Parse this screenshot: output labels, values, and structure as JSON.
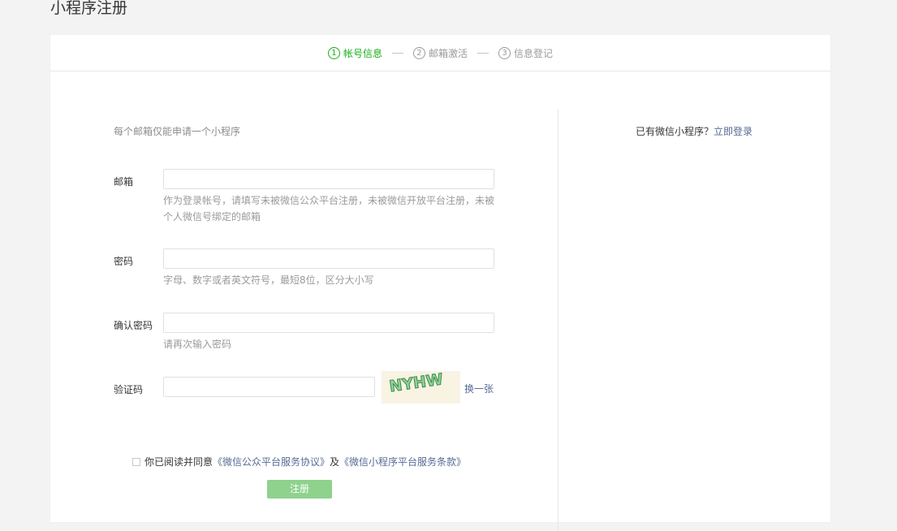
{
  "page": {
    "title": "小程序注册"
  },
  "steps": [
    {
      "num": "1",
      "label": "帐号信息"
    },
    {
      "num": "2",
      "label": "邮箱激活"
    },
    {
      "num": "3",
      "label": "信息登记"
    }
  ],
  "form": {
    "intro": "每个邮箱仅能申请一个小程序",
    "email": {
      "label": "邮箱",
      "value": "",
      "hint": "作为登录帐号，请填写未被微信公众平台注册，未被微信开放平台注册，未被个人微信号绑定的邮箱"
    },
    "password": {
      "label": "密码",
      "value": "",
      "hint": "字母、数字或者英文符号，最短8位，区分大小写"
    },
    "confirm_password": {
      "label": "确认密码",
      "value": "",
      "hint": "请再次输入密码"
    },
    "captcha": {
      "label": "验证码",
      "value": "",
      "image_text": "NYHW",
      "switch_label": "换一张"
    },
    "agreement": {
      "prefix": "你已阅读并同意",
      "link1": "《微信公众平台服务协议》",
      "and": "及",
      "link2": "《微信小程序平台服务条款》"
    },
    "submit_label": "注册"
  },
  "side": {
    "question": "已有微信小程序？",
    "login_link": "立即登录"
  },
  "colors": {
    "accent": "#1aad19",
    "link": "#576b95",
    "button_disabled": "#8ed28d",
    "captcha_bg": "#f8f3e3",
    "captcha_letters": "#4a9a54"
  }
}
